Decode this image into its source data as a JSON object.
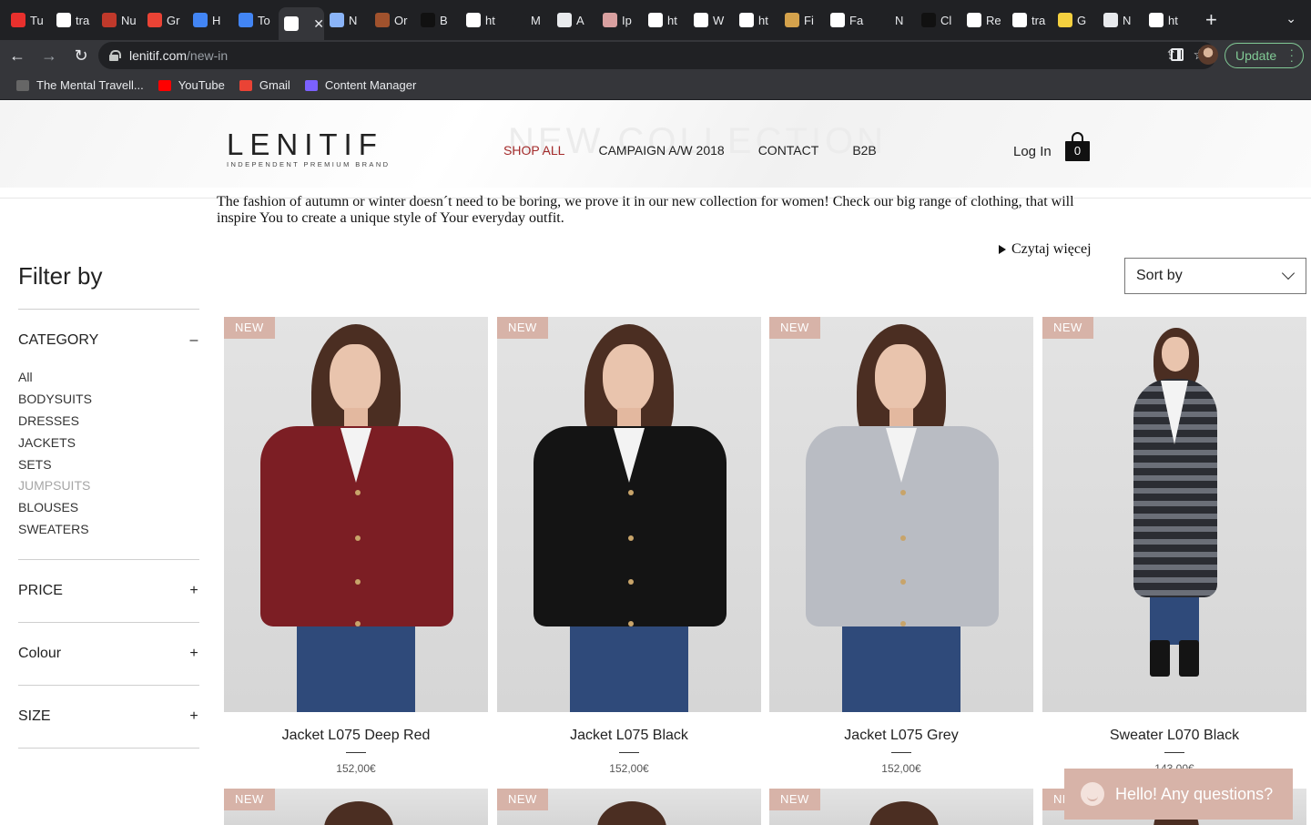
{
  "browser": {
    "tabs": [
      {
        "label": "Tu",
        "icon": "tumblr-icon",
        "color": "#e8302d"
      },
      {
        "label": "tra",
        "icon": "google-icon",
        "color": "#ffffff"
      },
      {
        "label": "Nu",
        "icon": "shield-crest-icon",
        "color": "#c0392b"
      },
      {
        "label": "Gr",
        "icon": "gmail-icon",
        "color": "#ea4335"
      },
      {
        "label": "H",
        "icon": "google-docs-icon",
        "color": "#4285f4"
      },
      {
        "label": "To",
        "icon": "google-docs-icon",
        "color": "#4285f4"
      },
      {
        "label": "",
        "icon": "lenitif-icon",
        "color": "#ffffff",
        "active": true
      },
      {
        "label": "N",
        "icon": "loading-icon",
        "color": "#8ab4f8"
      },
      {
        "label": "Or",
        "icon": "target-icon",
        "color": "#a0522d"
      },
      {
        "label": "B",
        "icon": "letter-b-icon",
        "color": "#111111"
      },
      {
        "label": "ht",
        "icon": "letter-l-icon",
        "color": "#ffffff"
      },
      {
        "label": "M",
        "icon": "blank-icon",
        "color": "#202124"
      },
      {
        "label": "A",
        "icon": "clock-icon",
        "color": "#e8eaed"
      },
      {
        "label": "Ip",
        "icon": "flower-icon",
        "color": "#d9a0a0"
      },
      {
        "label": "ht",
        "icon": "letter-l-icon",
        "color": "#ffffff"
      },
      {
        "label": "W",
        "icon": "letter-l-icon",
        "color": "#ffffff"
      },
      {
        "label": "ht",
        "icon": "letter-l-icon",
        "color": "#ffffff"
      },
      {
        "label": "Fi",
        "icon": "letter-f-icon",
        "color": "#d4a24c"
      },
      {
        "label": "Fa",
        "icon": "letter-l-icon",
        "color": "#ffffff"
      },
      {
        "label": "N",
        "icon": "letter-l-icon",
        "color": "#202124"
      },
      {
        "label": "Cl",
        "icon": "letter-c-icon",
        "color": "#111111"
      },
      {
        "label": "Re",
        "icon": "letter-l-icon",
        "color": "#ffffff"
      },
      {
        "label": "tra",
        "icon": "google-icon",
        "color": "#ffffff"
      },
      {
        "label": "G",
        "icon": "ukraine-icon",
        "color": "#f4d03f"
      },
      {
        "label": "N",
        "icon": "chrome-icon",
        "color": "#e8eaed"
      },
      {
        "label": "ht",
        "icon": "letter-l-icon",
        "color": "#ffffff"
      }
    ],
    "url_host": "lenitif.com",
    "url_path": "/new-in",
    "update_label": "Update",
    "bookmarks": [
      {
        "label": "The Mental Travell...",
        "icon": "bookmark-site-icon",
        "color": "#666666"
      },
      {
        "label": "YouTube",
        "icon": "youtube-icon",
        "color": "#ff0000"
      },
      {
        "label": "Gmail",
        "icon": "gmail-icon",
        "color": "#ea4335"
      },
      {
        "label": "Content Manager",
        "icon": "content-manager-icon",
        "color": "#7b61ff"
      }
    ]
  },
  "header": {
    "logo_word": "LENITIF",
    "logo_tagline": "INDEPENDENT PREMIUM BRAND",
    "bg_text": "NEW COLLECTION",
    "nav": [
      "SHOP ALL",
      "CAMPAIGN A/W 2018",
      "CONTACT",
      "B2B"
    ],
    "login": "Log In",
    "cart_count": "0"
  },
  "intro": {
    "text": "The fashion of autumn or winter doesn´t need to be boring, we prove it in our new collection for women! Check our big range of clothing, that will inspire You to create a unique style of Your everyday outfit.",
    "read_more": "Czytaj więcej"
  },
  "filter": {
    "title": "Filter by",
    "category": {
      "label": "CATEGORY",
      "toggle": "–",
      "items": [
        {
          "label": "All",
          "muted": false
        },
        {
          "label": "BODYSUITS",
          "muted": false
        },
        {
          "label": "DRESSES",
          "muted": false
        },
        {
          "label": "JACKETS",
          "muted": false
        },
        {
          "label": "SETS",
          "muted": false
        },
        {
          "label": "JUMPSUITS",
          "muted": true
        },
        {
          "label": "BLOUSES",
          "muted": false
        },
        {
          "label": "SWEATERS",
          "muted": false
        }
      ]
    },
    "price": {
      "label": "PRICE",
      "toggle": "+"
    },
    "colour": {
      "label": "Colour",
      "toggle": "+"
    },
    "size": {
      "label": "SIZE",
      "toggle": "+"
    }
  },
  "sort": {
    "label": "Sort by"
  },
  "products": [
    {
      "badge": "NEW",
      "name": "Jacket L075 Deep Red",
      "price": "152,00€",
      "garment_color": "#7c1e24"
    },
    {
      "badge": "NEW",
      "name": "Jacket L075 Black",
      "price": "152,00€",
      "garment_color": "#141414"
    },
    {
      "badge": "NEW",
      "name": "Jacket L075 Grey",
      "price": "152,00€",
      "garment_color": "#b9bcc3"
    },
    {
      "badge": "NEW",
      "name": "Sweater L070 Black",
      "price": "143,00€",
      "garment_color": "#2b2d33"
    }
  ],
  "products_row2": [
    {
      "badge": "NEW"
    },
    {
      "badge": "NEW"
    },
    {
      "badge": "NEW"
    },
    {
      "badge": "NEW"
    }
  ],
  "chat": {
    "label": "Hello! Any questions?"
  }
}
